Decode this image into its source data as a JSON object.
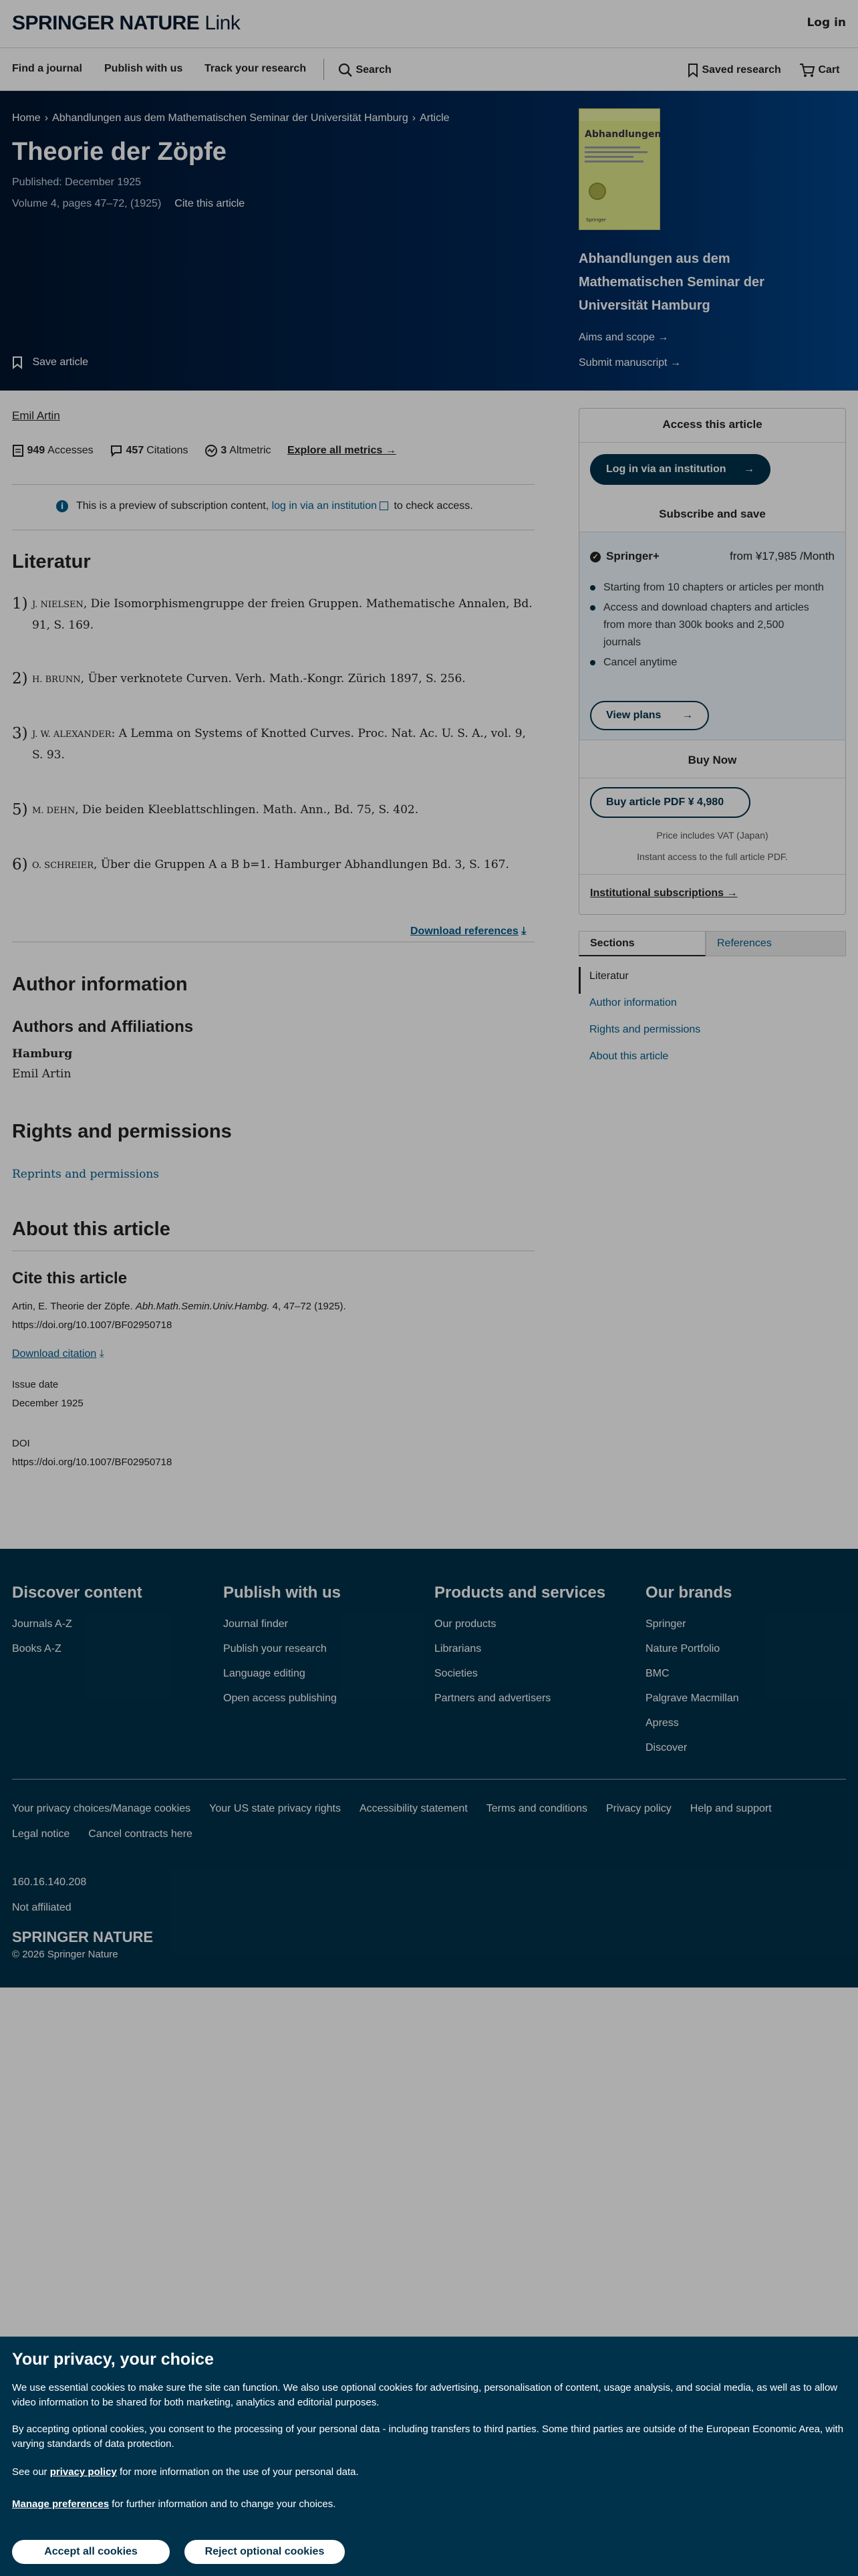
{
  "header": {
    "brand": "SPRINGER NATURE",
    "brand_link": "Link",
    "login": "Log in"
  },
  "nav": {
    "find_journal": "Find a journal",
    "publish": "Publish with us",
    "track": "Track your research",
    "search": "Search",
    "saved": "Saved research",
    "cart": "Cart"
  },
  "breadcrumb": {
    "home": "Home",
    "journal": "Abhandlungen aus dem Mathematischen Seminar der Universität Hamburg",
    "current": "Article"
  },
  "article": {
    "title": "Theorie der Zöpfe",
    "published": "Published: December 1925",
    "volume": "Volume 4, pages 47–72, (1925)",
    "cite_link": "Cite this article",
    "save": "Save article",
    "author": "Emil Artin"
  },
  "journal_box": {
    "name": "Abhandlungen aus dem Mathematischen Seminar der Universität Hamburg",
    "cover_title": "Abhandlungen",
    "cover_publisher": "Springer",
    "aims": "Aims and scope →",
    "submit": "Submit manuscript →"
  },
  "metrics": {
    "accesses_num": "949",
    "accesses_label": "Accesses",
    "citations_num": "457",
    "citations_label": "Citations",
    "altmetric_num": "3",
    "altmetric_label": "Altmetric",
    "explore": "Explore all metrics →"
  },
  "preview": {
    "pre": "This is a preview of subscription content, ",
    "link": "log in via an institution",
    "post": " to check access."
  },
  "literatur": {
    "heading": "Literatur",
    "refs": [
      {
        "num": "1)",
        "author": "J. NIELSEN",
        "text": ", Die Isomorphismengruppe der freien Gruppen. Mathematische Annalen, Bd. 91, S. 169."
      },
      {
        "num": "2)",
        "author": "H. BRUNN",
        "text": ", Über verknotete Curven. Verh. Math.-Kongr. Zürich 1897, S. 256."
      },
      {
        "num": "3)",
        "author": "J. W. ALEXANDER",
        "text": ": A Lemma on Systems of Knotted Curves. Proc. Nat. Ac. U. S. A., vol. 9, S. 93."
      },
      {
        "num": "5)",
        "author": "M. DEHN",
        "text": ", Die beiden Kleeblattschlingen. Math. Ann., Bd. 75, S. 402."
      },
      {
        "num": "6)",
        "author": "O. SCHREIER",
        "text": ", Über die Gruppen A a B b=1. Hamburger Abhandlungen Bd. 3, S. 167."
      }
    ],
    "download": "Download references"
  },
  "author_info": {
    "heading": "Author information",
    "sub": "Authors and Affiliations",
    "org": "Hamburg",
    "person": "Emil Artin"
  },
  "rights": {
    "heading": "Rights and permissions",
    "link": "Reprints and permissions"
  },
  "about": {
    "heading": "About this article",
    "cite_heading": "Cite this article",
    "citation_pre": "Artin, E. Theorie der Zöpfe. ",
    "citation_journal": "Abh.Math.Semin.Univ.Hambg.",
    "citation_post": " 4, 47–72 (1925).",
    "doi_url": "https://doi.org/10.1007/BF02950718",
    "download_citation": "Download citation",
    "issue_label": "Issue date",
    "issue_value": "December 1925",
    "doi_label": "DOI",
    "doi_value": "https://doi.org/10.1007/BF02950718"
  },
  "access": {
    "title": "Access this article",
    "login_btn": "Log in via an institution",
    "subscribe_title": "Subscribe and save",
    "plus_name": "Springer+",
    "plus_price": "from ¥17,985 /Month",
    "features": [
      "Starting from 10 chapters or articles per month",
      "Access and download chapters and articles from more than 300k books and 2,500 journals",
      "Cancel anytime"
    ],
    "view_plans": "View plans",
    "buy_title": "Buy Now",
    "buy_btn": "Buy article PDF ¥ 4,980",
    "vat": "Price includes VAT (Japan)",
    "instant": "Instant access to the full article PDF.",
    "institutional": "Institutional subscriptions →"
  },
  "sidebar_tabs": {
    "sections": "Sections",
    "references": "References"
  },
  "section_links": [
    "Literatur",
    "Author information",
    "Rights and permissions",
    "About this article"
  ],
  "footer": {
    "cols": [
      {
        "title": "Discover content",
        "links": [
          "Journals A-Z",
          "Books A-Z"
        ]
      },
      {
        "title": "Publish with us",
        "links": [
          "Journal finder",
          "Publish your research",
          "Language editing",
          "Open access publishing"
        ]
      },
      {
        "title": "Products and services",
        "links": [
          "Our products",
          "Librarians",
          "Societies",
          "Partners and advertisers"
        ]
      },
      {
        "title": "Our brands",
        "links": [
          "Springer",
          "Nature Portfolio",
          "BMC",
          "Palgrave Macmillan",
          "Apress",
          "Discover"
        ]
      }
    ],
    "legal": [
      "Your privacy choices/Manage cookies",
      "Your US state privacy rights",
      "Accessibility statement",
      "Terms and conditions",
      "Privacy policy",
      "Help and support",
      "Legal notice",
      "Cancel contracts here"
    ],
    "ip": "160.16.140.208",
    "affiliation": "Not affiliated",
    "brand": "SPRINGER NATURE",
    "copyright": "© 2026 Springer Nature"
  },
  "cookie": {
    "title": "Your privacy, your choice",
    "p1": "We use essential cookies to make sure the site can function. We also use optional cookies for advertising, personalisation of content, usage analysis, and social media, as well as to allow video information to be shared for both marketing, analytics and editorial purposes.",
    "p2": "By accepting optional cookies, you consent to the processing of your personal data - including transfers to third parties. Some third parties are outside of the European Economic Area, with varying standards of data protection.",
    "p3_pre": "See our ",
    "p3_link": "privacy policy",
    "p3_post": " for more information on the use of your personal data.",
    "p4_link": "Manage preferences",
    "p4_post": " for further information and to change your choices.",
    "accept": "Accept all cookies",
    "reject": "Reject optional cookies"
  }
}
